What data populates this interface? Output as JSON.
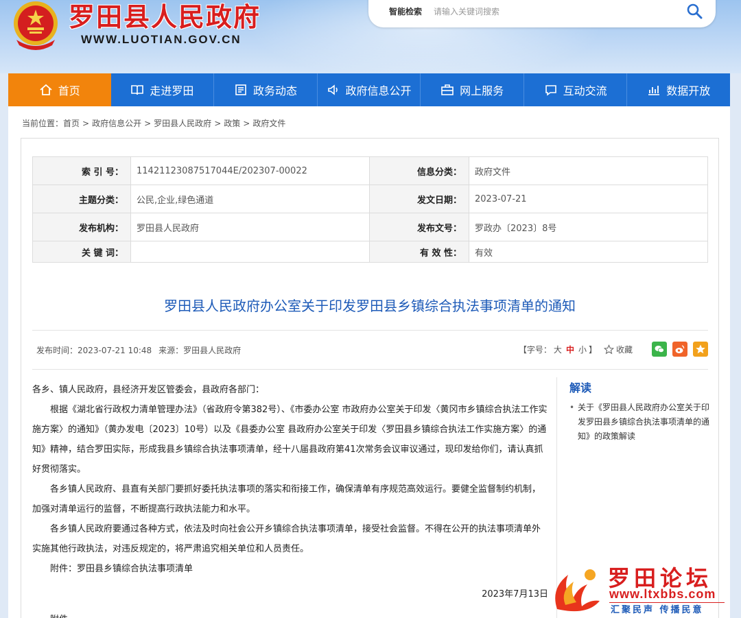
{
  "header": {
    "site_title": "罗田县人民政府",
    "site_url": "WWW.LUOTIAN.GOV.CN",
    "search_label": "智能检索",
    "search_placeholder": "请输入关键词搜索"
  },
  "nav": {
    "items": [
      {
        "label": "首页",
        "icon": "home-icon",
        "active": true
      },
      {
        "label": "走进罗田",
        "icon": "book-icon"
      },
      {
        "label": "政务动态",
        "icon": "news-icon"
      },
      {
        "label": "政府信息公开",
        "icon": "speaker-icon"
      },
      {
        "label": "网上服务",
        "icon": "briefcase-icon"
      },
      {
        "label": "互动交流",
        "icon": "chat-icon"
      },
      {
        "label": "数据开放",
        "icon": "chart-icon"
      }
    ]
  },
  "breadcrumb": {
    "prefix": "当前位置：",
    "items": [
      "首页",
      "政府信息公开",
      "罗田县人民政府",
      "政策",
      "政府文件"
    ],
    "separator": ">"
  },
  "meta": {
    "index_label": "索 引 号：",
    "index_value": "11421123087517044E/202307-00022",
    "category_label": "信息分类：",
    "category_value": "政府文件",
    "topic_label": "主题分类：",
    "topic_value": "公民,企业,绿色通道",
    "date_label": "发文日期：",
    "date_value": "2023-07-21",
    "org_label": "发布机构：",
    "org_value": "罗田县人民政府",
    "docno_label": "发布文号：",
    "docno_value": "罗政办〔2023〕8号",
    "keyword_label": "关 键 词：",
    "keyword_value": "",
    "validity_label": "有 效 性：",
    "validity_value": "有效"
  },
  "article": {
    "title": "罗田县人民政府办公室关于印发罗田县乡镇综合执法事项清单的通知",
    "publish_time": "发布时间：2023-07-21 10:48",
    "source": "来源：罗田县人民政府",
    "font_size_prefix": "【字号：",
    "font_large": "大",
    "font_medium": "中",
    "font_small": "小",
    "font_size_suffix": "】",
    "favorite": "收藏",
    "salutation": "各乡、镇人民政府，县经济开发区管委会，县政府各部门：",
    "paragraphs": [
      "根据《湖北省行政权力清单管理办法》（省政府令第382号）、《市委办公室 市政府办公室关于印发〈黄冈市乡镇综合执法工作实施方案〉的通知》（黄办发电〔2023〕10号）以及《县委办公室 县政府办公室关于印发〈罗田县乡镇综合执法工作实施方案〉的通知》精神，结合罗田实际，形成我县乡镇综合执法事项清单，经十八届县政府第41次常务会议审议通过，现印发给你们，请认真抓好贯彻落实。",
      "各乡镇人民政府、县直有关部门要抓好委托执法事项的落实和衔接工作，确保清单有序规范高效运行。要健全监督制约机制，加强对清单运行的监督，不断提高行政执法能力和水平。",
      "各乡镇人民政府要通过各种方式，依法及时向社会公开乡镇综合执法事项清单，接受社会监督。不得在公开的执法事项清单外实施其他行政执法，对违反规定的，将严肃追究相关单位和人员责任。",
      "附件：罗田县乡镇综合执法事项清单"
    ],
    "sign_date": "2023年7月13日",
    "attachment_label": "附件"
  },
  "sidebar": {
    "heading": "解读",
    "items": [
      "关于《罗田县人民政府办公室关于印发罗田县乡镇综合执法事项清单的通知》的政策解读"
    ]
  },
  "watermark": {
    "title": "罗田论坛",
    "url": "www.ltxbbs.com",
    "slogan": "汇聚民声 传播民意"
  },
  "colors": {
    "nav_bg": "#1c6fd4",
    "nav_active": "#f2840c",
    "title_red": "#d81e1e",
    "doc_title_blue": "#1e5bb8"
  }
}
